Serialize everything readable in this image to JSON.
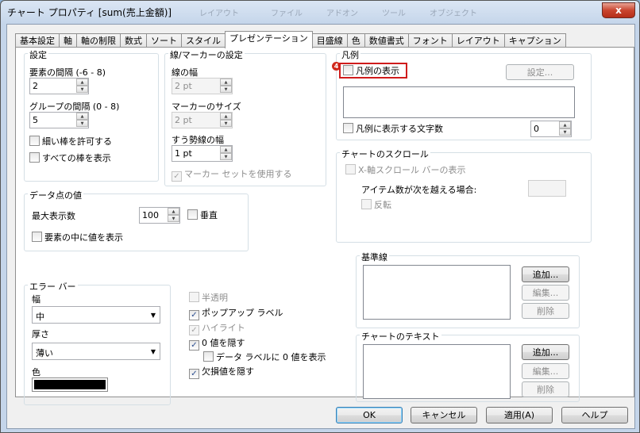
{
  "window": {
    "title": "チャート プロパティ [sum(売上金額)]",
    "ghost_title": "レイアウト　　　　ファイル　　　アドオン　　　ツール　　　オブジェクト",
    "close_label": "x"
  },
  "tabs": [
    "基本設定",
    "軸",
    "軸の制限",
    "数式",
    "ソート",
    "スタイル",
    "プレゼンテーション",
    "目盛線",
    "色",
    "数値書式",
    "フォント",
    "レイアウト",
    "キャプション"
  ],
  "active_tab": "プレゼンテーション",
  "settings": {
    "title": "設定",
    "spacing_label": "要素の間隔 (-6 - 8)",
    "spacing_value": "2",
    "group_spacing_label": "グループの間隔 (0 - 8)",
    "group_spacing_value": "5",
    "allow_thin_bars": "細い棒を許可する",
    "show_all_bars": "すべての棒を表示"
  },
  "line_marker": {
    "title": "線/マーカーの設定",
    "line_width_label": "線の幅",
    "line_width_value": "2 pt",
    "marker_size_label": "マーカーのサイズ",
    "marker_size_value": "2 pt",
    "trend_width_label": "すう勢線の幅",
    "trend_width_value": "1 pt",
    "use_marker_set": "マーカー セットを使用する"
  },
  "data_values": {
    "title": "データ点の値",
    "max_label": "最大表示数",
    "max_value": "100",
    "vertical": "垂直",
    "show_in_segment": "要素の中に値を表示"
  },
  "error_bars": {
    "title": "エラー バー",
    "width_label": "幅",
    "width_value": "中",
    "thickness_label": "厚さ",
    "thickness_value": "薄い",
    "color_label": "色",
    "color": "#000000"
  },
  "options": {
    "semi_transparent": "半透明",
    "popup_labels": "ポップアップ ラベル",
    "highlight": "ハイライト",
    "suppress_zero": "0 値を隠す",
    "zero_on_bars": "データ ラベルに 0 値を表示",
    "suppress_missing": "欠損値を隠す"
  },
  "legend": {
    "title": "凡例",
    "show_legend": "凡例の表示",
    "settings_button": "設定...",
    "limit_chars": "凡例に表示する文字数",
    "limit_chars_value": "0",
    "highlight_color": "#d01c1c",
    "marker_label": "4"
  },
  "chart_scroll": {
    "title": "チャートのスクロール",
    "enable_x_scroll": "X-軸スクロール バーの表示",
    "items_over": "アイテム数が次を越える場合:",
    "reversed": "反転"
  },
  "reference_lines": {
    "title": "基準線",
    "add": "追加...",
    "edit": "編集...",
    "delete": "削除"
  },
  "chart_text": {
    "title": "チャートのテキスト",
    "add": "追加...",
    "edit": "編集...",
    "delete": "削除"
  },
  "footer": {
    "ok": "OK",
    "cancel": "キャンセル",
    "apply": "適用(A)",
    "help": "ヘルプ"
  }
}
